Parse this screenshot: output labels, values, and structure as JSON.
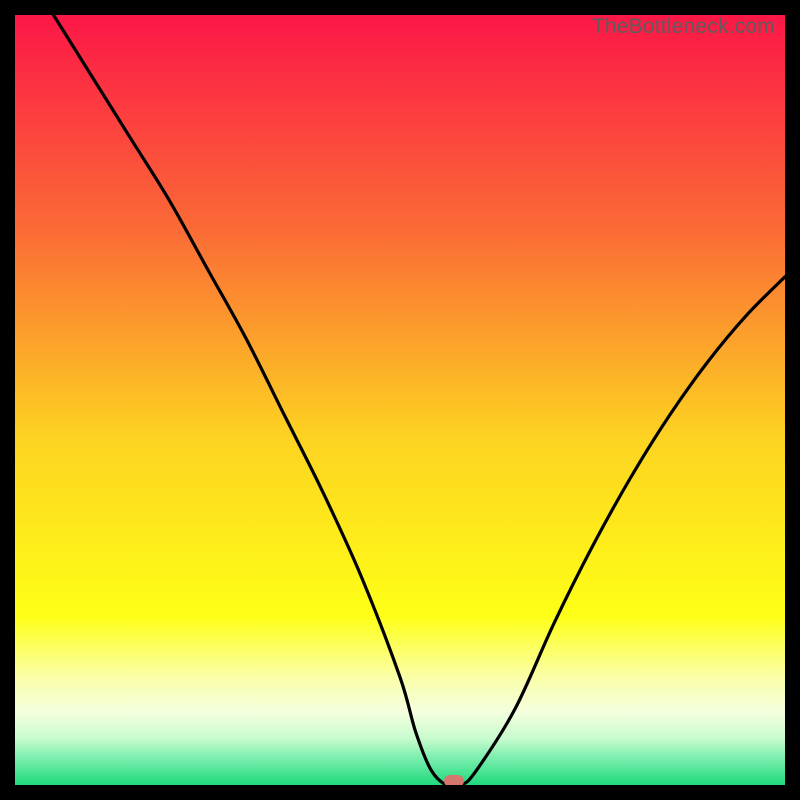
{
  "watermark": "TheBottleneck.com",
  "colors": {
    "black": "#000000",
    "curve": "#000000",
    "marker": "#d6776e",
    "watermark_text": "#5d5d5d"
  },
  "chart_data": {
    "type": "line",
    "title": "",
    "xlabel": "",
    "ylabel": "",
    "xlim": [
      0,
      100
    ],
    "ylim": [
      0,
      100
    ],
    "annotations": [
      "TheBottleneck.com"
    ],
    "x": [
      5,
      10,
      15,
      20,
      25,
      30,
      35,
      40,
      45,
      50,
      52,
      54,
      56,
      58,
      60,
      65,
      70,
      75,
      80,
      85,
      90,
      95,
      100
    ],
    "values": [
      100,
      92,
      84,
      76,
      67,
      58,
      48,
      38,
      27,
      14,
      7,
      2,
      0,
      0,
      2,
      10,
      21,
      31,
      40,
      48,
      55,
      61,
      66
    ],
    "marker": {
      "x": 57,
      "y": 0
    },
    "gradient_stops": [
      {
        "pos": 0.0,
        "color": "#fc1747"
      },
      {
        "pos": 0.28,
        "color": "#fb6b36"
      },
      {
        "pos": 0.55,
        "color": "#fdd321"
      },
      {
        "pos": 0.78,
        "color": "#feff16"
      },
      {
        "pos": 0.86,
        "color": "#fbffa8"
      },
      {
        "pos": 0.905,
        "color": "#f4ffde"
      },
      {
        "pos": 0.94,
        "color": "#c7fbce"
      },
      {
        "pos": 0.965,
        "color": "#7beeae"
      },
      {
        "pos": 1.0,
        "color": "#1ed97c"
      }
    ]
  }
}
